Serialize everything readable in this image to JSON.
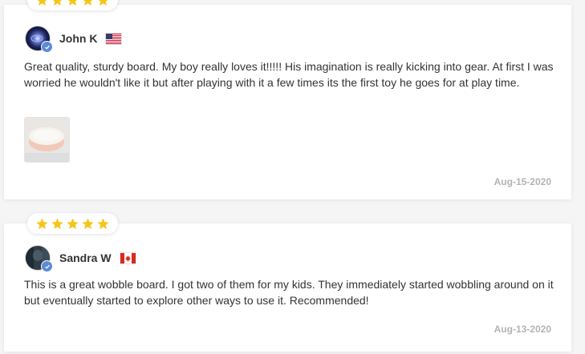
{
  "reviews": [
    {
      "rating": 5,
      "reviewer": "John K",
      "country_flag": "us-flag-icon",
      "text": "Great quality, sturdy board. My boy really loves it!!!!! His imagination is really kicking into gear. At first I was worried he wouldn't like it but after playing with it a few times its the first toy he goes for at play time.",
      "has_photo": true,
      "date": "Aug-15-2020"
    },
    {
      "rating": 5,
      "reviewer": "Sandra W",
      "country_flag": "ca-flag-icon",
      "text": "This is a great wobble board. I got two of them for my kids. They immediately started wobbling around on it but eventually started to explore other ways to use it. Recommended!",
      "has_photo": false,
      "date": "Aug-13-2020"
    }
  ],
  "colors": {
    "star": "#f5c518",
    "verified_badge": "#5d8ad6",
    "date_text": "#b3b3b3"
  }
}
